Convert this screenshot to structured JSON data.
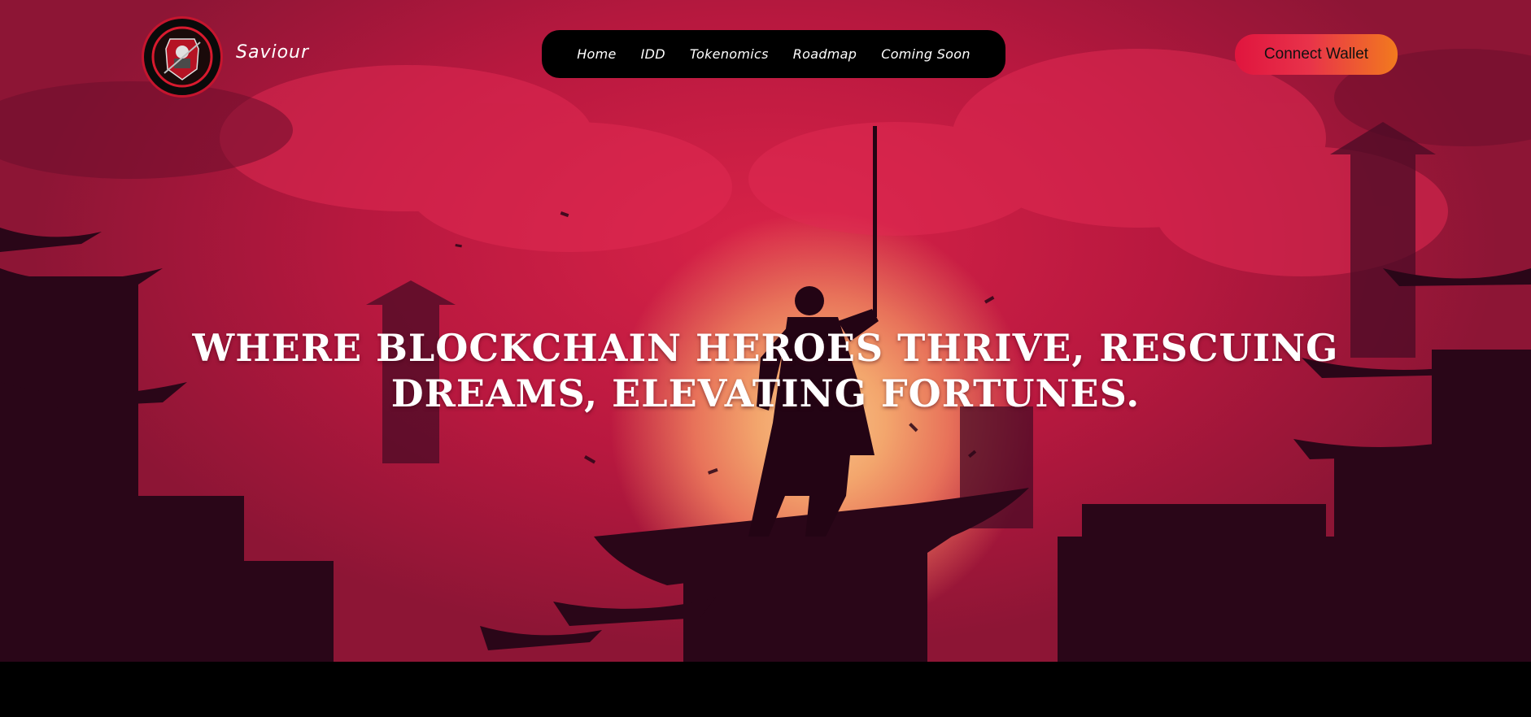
{
  "brand": {
    "name": "Saviour",
    "logo_icon": "samurai-emblem-icon"
  },
  "nav": {
    "items": [
      {
        "label": "Home"
      },
      {
        "label": "IDD"
      },
      {
        "label": "Tokenomics"
      },
      {
        "label": "Roadmap"
      },
      {
        "label": "Coming Soon"
      }
    ]
  },
  "connect_wallet": {
    "label": "Connect Wallet"
  },
  "hero": {
    "headline": "WHERE BLOCKCHAIN HEROES THRIVE, RESCUING DREAMS, ELEVATING FORTUNES.",
    "background_icon": "samurai-silhouette-sunset-illustration"
  },
  "colors": {
    "hero_red": "#c81c44",
    "sun": "#f7c48a",
    "silhouette": "#2a0618",
    "accent_start": "#e0153e",
    "accent_end": "#f27a1e",
    "nav_bg": "#000000"
  }
}
